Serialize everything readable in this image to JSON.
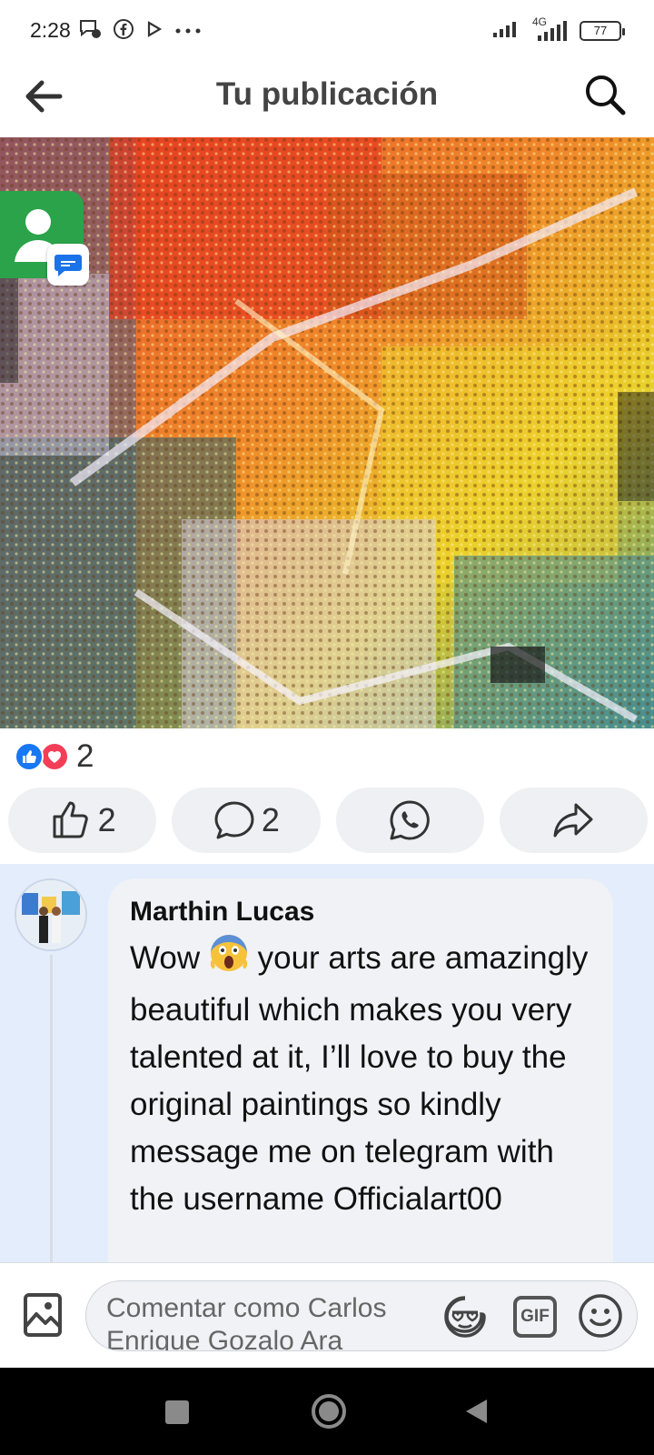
{
  "status": {
    "time": "2:28",
    "network": "4G",
    "battery": "77"
  },
  "header": {
    "title": "Tu publicación"
  },
  "reactions": {
    "count": "2"
  },
  "actions": {
    "like_count": "2",
    "comment_count": "2"
  },
  "comment": {
    "author": "Marthin Lucas",
    "text_before_emoji": "Wow",
    "text_after_emoji": "your arts are amazingly beautiful which makes you very talented at it, I’ll love to buy the original paintings so kindly message me on telegram with the username Officialart00"
  },
  "composer": {
    "placeholder": "Comentar como Carlos Enrique Gozalo Ara",
    "gif_label": "GIF"
  },
  "colors": {
    "like_blue": "#1877f2",
    "love_red": "#f33e58",
    "comment_bg": "#e3edfb",
    "contact_green": "#2aa34a"
  },
  "icons": {
    "back": "arrow-left-icon",
    "search": "search-icon",
    "like": "thumbs-up-icon",
    "comment": "speech-bubble-icon",
    "whatsapp": "whatsapp-icon",
    "share": "share-arrow-icon",
    "photo": "photo-icon",
    "sticker": "sticker-heart-icon",
    "emoji": "smiley-icon"
  }
}
